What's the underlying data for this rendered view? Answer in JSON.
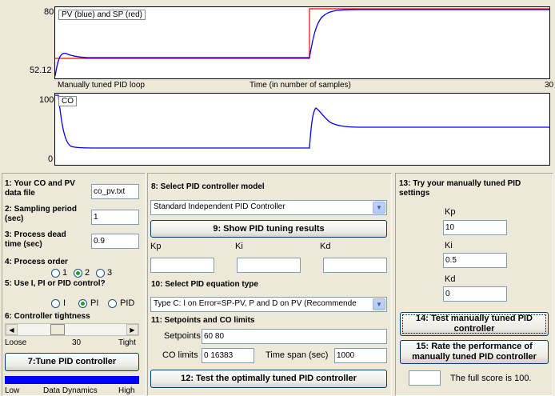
{
  "plot1": {
    "y_max": "80",
    "y_min": "52.12",
    "legend": "PV (blue) and SP (red)",
    "left_caption": "Manually tuned PID loop",
    "x_caption": "Time (in number of samples)",
    "x_max": "30"
  },
  "plot2": {
    "y_max": "100",
    "y_min": "0",
    "legend": "CO"
  },
  "chart_data": [
    {
      "type": "line",
      "legend": [
        "PV (blue) and SP (red)"
      ],
      "xlabel": "Time (in number of samples)",
      "ylim": [
        52.12,
        80
      ],
      "colors": {
        "pv": "#0000ff",
        "sp": "#ff0000"
      }
    },
    {
      "type": "line",
      "legend": [
        "CO"
      ],
      "ylim": [
        0,
        100
      ],
      "colors": {
        "co": "#0000ff"
      }
    }
  ],
  "left_panel": {
    "data_file_label": "1: Your CO and PV data file",
    "data_file_value": "co_pv.txt",
    "sampling_label": "2: Sampling period (sec)",
    "sampling_value": "1",
    "dead_time_label": "3: Process dead time (sec)",
    "dead_time_value": "0.9",
    "order_label": "4: Process order",
    "order_options": [
      "1",
      "2",
      "3"
    ],
    "order_selected": "2",
    "control_label": "5: Use I, PI or PID control?",
    "control_options": [
      "I",
      "PI",
      "PID"
    ],
    "control_selected": "PI",
    "tightness_label": "6: Controller tightness",
    "loose": "Loose",
    "tight": "Tight",
    "tightness_value": "30",
    "tune_button": "7:Tune PID controller",
    "dyn_low": "Low",
    "dyn_label": "Data Dynamics",
    "dyn_high": "High"
  },
  "mid_panel": {
    "model_label": "8: Select PID controller model",
    "model_value": "Standard Independent PID Controller",
    "show_button": "9: Show PID tuning results",
    "kp": "Kp",
    "ki": "Ki",
    "kd": "Kd",
    "kp_value": "",
    "ki_value": "",
    "kd_value": "",
    "eq_label": "10: Select PID equation type",
    "eq_value": "Type C: I on Error=SP-PV, P and D on PV (Recommende",
    "limits_label": "11: Setpoints and CO limits",
    "setpoints_label": "Setpoints",
    "setpoints_value": "60 80",
    "colimits_label": "CO limits",
    "colimits_value": "0 16383",
    "timespan_label": "Time span (sec)",
    "timespan_value": "1000",
    "test_button": "12: Test the optimally tuned PID controller"
  },
  "right_panel": {
    "try_label": "13: Try your manually tuned PID settings",
    "kp": "Kp",
    "kp_value": "10",
    "ki": "Ki",
    "ki_value": "0.5",
    "kd": "Kd",
    "kd_value": "0",
    "test_button": "14: Test manually tuned PID controller",
    "rate_label": "15: Rate the performance of manually tuned PID controller",
    "score_value": "",
    "score_text": "The full score is 100."
  }
}
